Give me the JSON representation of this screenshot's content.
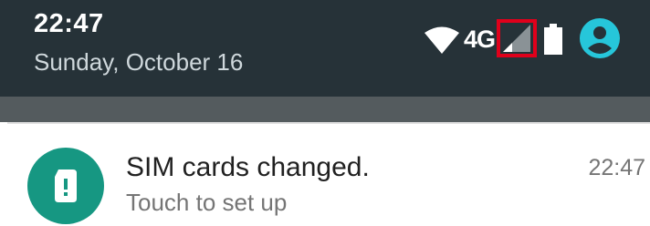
{
  "status_bar": {
    "time": "22:47",
    "date": "Sunday, October 16",
    "network_type": "4G",
    "icons": [
      "wifi-icon",
      "cell-signal-icon",
      "battery-icon",
      "account-icon"
    ]
  },
  "notification": {
    "app_icon": "sim-card-alert-icon",
    "title": "SIM cards changed.",
    "text": "Touch to set up",
    "time": "22:47"
  },
  "colors": {
    "header_bg": "#263238",
    "highlight_box": "#e0001b",
    "account_icon": "#26c6da",
    "notification_icon_bg": "#169782"
  }
}
